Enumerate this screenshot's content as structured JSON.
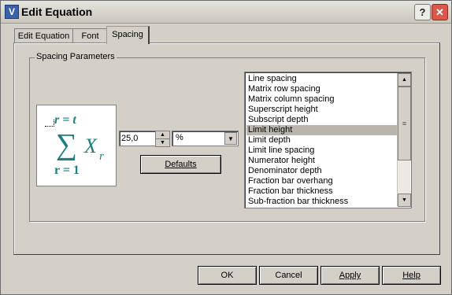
{
  "window": {
    "title": "Edit Equation",
    "app_icon": "V"
  },
  "title_buttons": {
    "help_glyph": "?",
    "close_glyph": "✕"
  },
  "tabs": [
    {
      "label": "Edit Equation"
    },
    {
      "label": "Font"
    },
    {
      "label": "Spacing"
    }
  ],
  "spacing": {
    "group_label": "Spacing Parameters",
    "preview": {
      "top": "r = t",
      "sigma": "∑",
      "var": "X",
      "sub": "r",
      "bottom": "r = 1"
    },
    "value": "25,0",
    "unit": "%",
    "defaults_label": "Defaults",
    "parameters": [
      "Line spacing",
      "Matrix row spacing",
      "Matrix column spacing",
      "Superscript height",
      "Subscript depth",
      "Limit height",
      "Limit depth",
      "Limit line spacing",
      "Numerator height",
      "Denominator depth",
      "Fraction bar overhang",
      "Fraction bar thickness",
      "Sub-fraction bar thickness"
    ],
    "selected_parameter": "Limit height"
  },
  "buttons": {
    "ok": "OK",
    "cancel": "Cancel",
    "apply": "Apply",
    "help": "Help"
  },
  "colors": {
    "preview_teal": "#1e7f7f",
    "dialog_face": "#d4d0c8",
    "close_red": "#d9584a"
  }
}
